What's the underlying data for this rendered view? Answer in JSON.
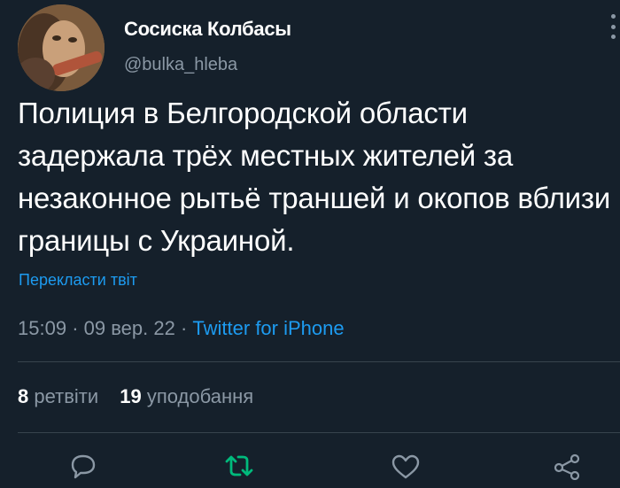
{
  "author": {
    "name": "Сосиска Колбасы",
    "handle": "@bulka_hleba"
  },
  "tweet": {
    "text": "Полиция в Белгородской области задержала трёх местных жителей за незаконное рытьё траншей и окопов вблизи границы с Украиной."
  },
  "translate_label": "Перекласти твіт",
  "meta": {
    "time": "15:09",
    "date": "09 вер. 22",
    "source": "Twitter for iPhone"
  },
  "stats": {
    "retweets_count": "8",
    "retweets_label": "ретвіти",
    "likes_count": "19",
    "likes_label": "уподобання"
  },
  "colors": {
    "background": "#15202b",
    "accent": "#1d9bf0",
    "retweet_green": "#00ba7c",
    "secondary_text": "#8b98a5"
  },
  "icons": {
    "reply": "reply-icon",
    "retweet": "retweet-icon",
    "like": "heart-icon",
    "share": "share-icon",
    "more": "more-icon"
  }
}
